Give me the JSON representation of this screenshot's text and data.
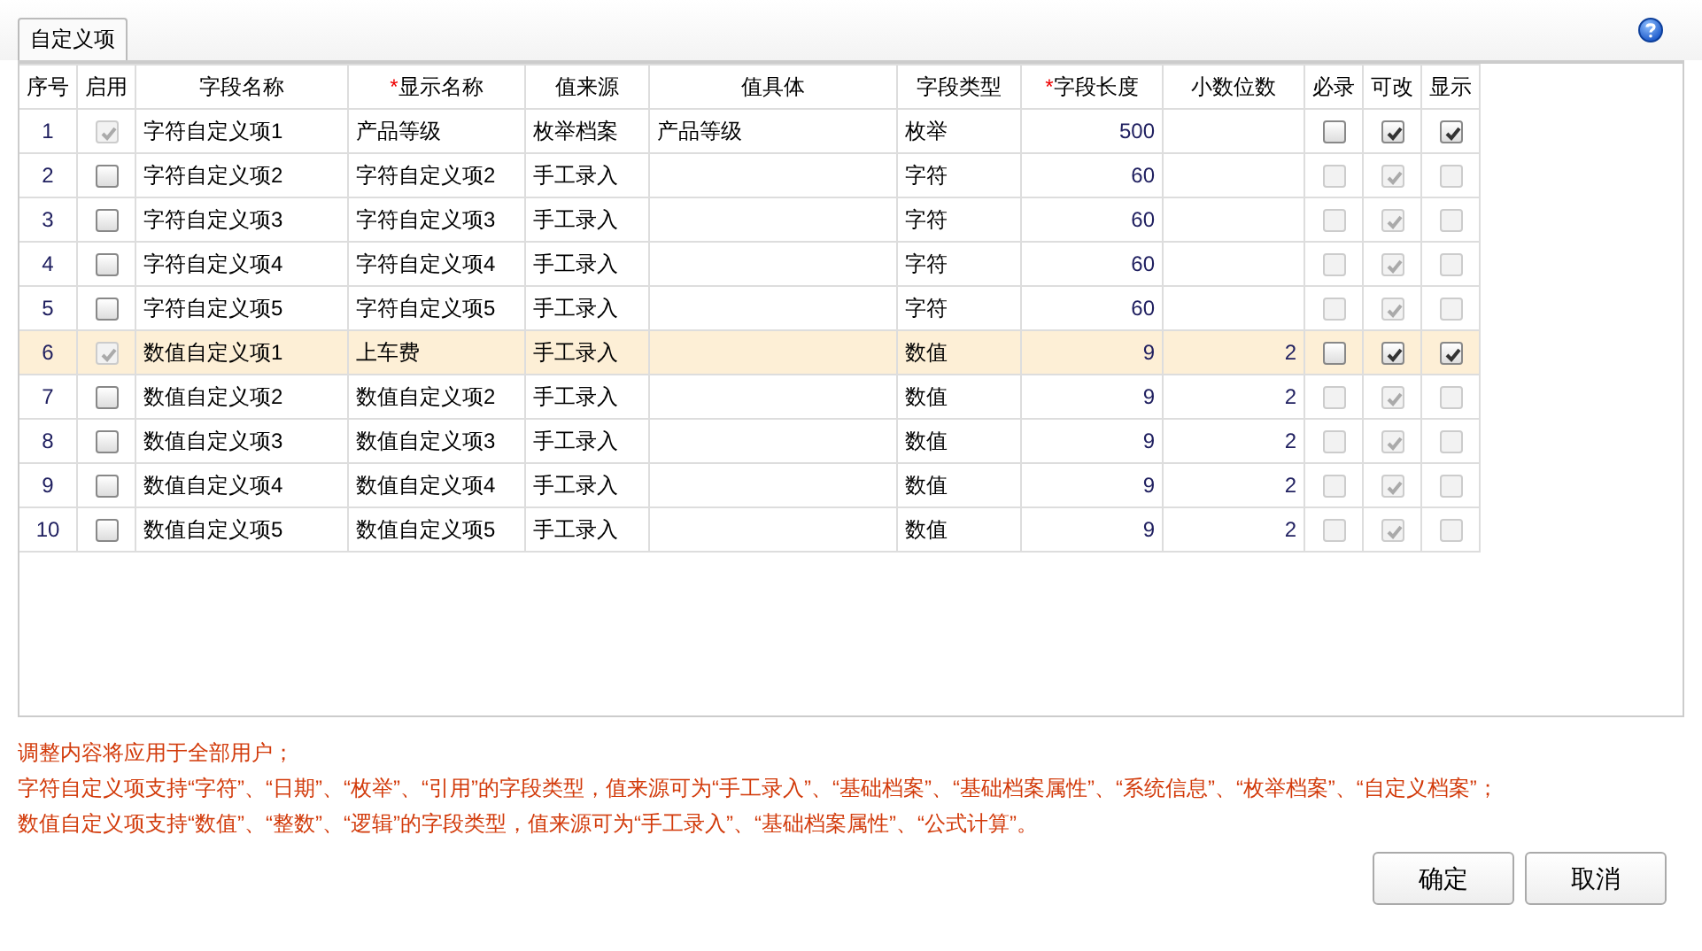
{
  "tabs": [
    {
      "label": "自定义项",
      "selected": true
    }
  ],
  "help": {
    "kind": "help"
  },
  "columns": [
    {
      "label": "序号",
      "kind": "index"
    },
    {
      "label": "启用",
      "kind": "check"
    },
    {
      "label": "字段名称",
      "kind": "text"
    },
    {
      "label": "显示名称",
      "kind": "text",
      "mark": "*"
    },
    {
      "label": "值来源",
      "kind": "text"
    },
    {
      "label": "值具体",
      "kind": "text"
    },
    {
      "label": "字段类型",
      "kind": "text"
    },
    {
      "label": "字段长度",
      "kind": "number",
      "mark": "*"
    },
    {
      "label": "小数位数",
      "kind": "number"
    },
    {
      "label": "必录",
      "kind": "check"
    },
    {
      "label": "可改",
      "kind": "check"
    },
    {
      "label": "显示",
      "kind": "check"
    }
  ],
  "rows": [
    {
      "selected": false,
      "cells": [
        "1",
        {
          "checked": true,
          "disabled": true
        },
        "字符自定义项1",
        "产品等级",
        "枚举档案",
        "产品等级",
        "枚举",
        "500",
        "",
        {
          "checked": false,
          "disabled": false
        },
        {
          "checked": true,
          "disabled": false
        },
        {
          "checked": true,
          "disabled": false
        }
      ]
    },
    {
      "selected": false,
      "cells": [
        "2",
        {
          "checked": false,
          "disabled": false
        },
        "字符自定义项2",
        "字符自定义项2",
        "手工录入",
        "",
        "字符",
        "60",
        "",
        {
          "checked": false,
          "disabled": true
        },
        {
          "checked": true,
          "disabled": true
        },
        {
          "checked": false,
          "disabled": true
        }
      ]
    },
    {
      "selected": false,
      "cells": [
        "3",
        {
          "checked": false,
          "disabled": false
        },
        "字符自定义项3",
        "字符自定义项3",
        "手工录入",
        "",
        "字符",
        "60",
        "",
        {
          "checked": false,
          "disabled": true
        },
        {
          "checked": true,
          "disabled": true
        },
        {
          "checked": false,
          "disabled": true
        }
      ]
    },
    {
      "selected": false,
      "cells": [
        "4",
        {
          "checked": false,
          "disabled": false
        },
        "字符自定义项4",
        "字符自定义项4",
        "手工录入",
        "",
        "字符",
        "60",
        "",
        {
          "checked": false,
          "disabled": true
        },
        {
          "checked": true,
          "disabled": true
        },
        {
          "checked": false,
          "disabled": true
        }
      ]
    },
    {
      "selected": false,
      "cells": [
        "5",
        {
          "checked": false,
          "disabled": false
        },
        "字符自定义项5",
        "字符自定义项5",
        "手工录入",
        "",
        "字符",
        "60",
        "",
        {
          "checked": false,
          "disabled": true
        },
        {
          "checked": true,
          "disabled": true
        },
        {
          "checked": false,
          "disabled": true
        }
      ]
    },
    {
      "selected": true,
      "cells": [
        "6",
        {
          "checked": true,
          "disabled": true
        },
        "数值自定义项1",
        "上车费",
        "手工录入",
        "",
        "数值",
        "9",
        "2",
        {
          "checked": false,
          "disabled": false
        },
        {
          "checked": true,
          "disabled": false
        },
        {
          "checked": true,
          "disabled": false
        }
      ]
    },
    {
      "selected": false,
      "cells": [
        "7",
        {
          "checked": false,
          "disabled": false
        },
        "数值自定义项2",
        "数值自定义项2",
        "手工录入",
        "",
        "数值",
        "9",
        "2",
        {
          "checked": false,
          "disabled": true
        },
        {
          "checked": true,
          "disabled": true
        },
        {
          "checked": false,
          "disabled": true
        }
      ]
    },
    {
      "selected": false,
      "cells": [
        "8",
        {
          "checked": false,
          "disabled": false
        },
        "数值自定义项3",
        "数值自定义项3",
        "手工录入",
        "",
        "数值",
        "9",
        "2",
        {
          "checked": false,
          "disabled": true
        },
        {
          "checked": true,
          "disabled": true
        },
        {
          "checked": false,
          "disabled": true
        }
      ]
    },
    {
      "selected": false,
      "cells": [
        "9",
        {
          "checked": false,
          "disabled": false
        },
        "数值自定义项4",
        "数值自定义项4",
        "手工录入",
        "",
        "数值",
        "9",
        "2",
        {
          "checked": false,
          "disabled": true
        },
        {
          "checked": true,
          "disabled": true
        },
        {
          "checked": false,
          "disabled": true
        }
      ]
    },
    {
      "selected": false,
      "cells": [
        "10",
        {
          "checked": false,
          "disabled": false
        },
        "数值自定义项5",
        "数值自定义项5",
        "手工录入",
        "",
        "数值",
        "9",
        "2",
        {
          "checked": false,
          "disabled": true
        },
        {
          "checked": true,
          "disabled": true
        },
        {
          "checked": false,
          "disabled": true
        }
      ]
    }
  ],
  "notes": [
    "调整内容将应用于全部用户；",
    "字符自定义项支持“字符”、“日期”、“枚举”、“引用”的字段类型，值来源可为“手工录入”、“基础档案”、“基础档案属性”、“系统信息”、“枚举档案”、“自定义档案”；",
    "数值自定义项支持“数值”、“整数”、“逻辑”的字段类型，值来源可为“手工录入”、“基础档案属性”、“公式计算”。"
  ],
  "buttons": [
    {
      "label": "确定"
    },
    {
      "label": "取消"
    }
  ]
}
